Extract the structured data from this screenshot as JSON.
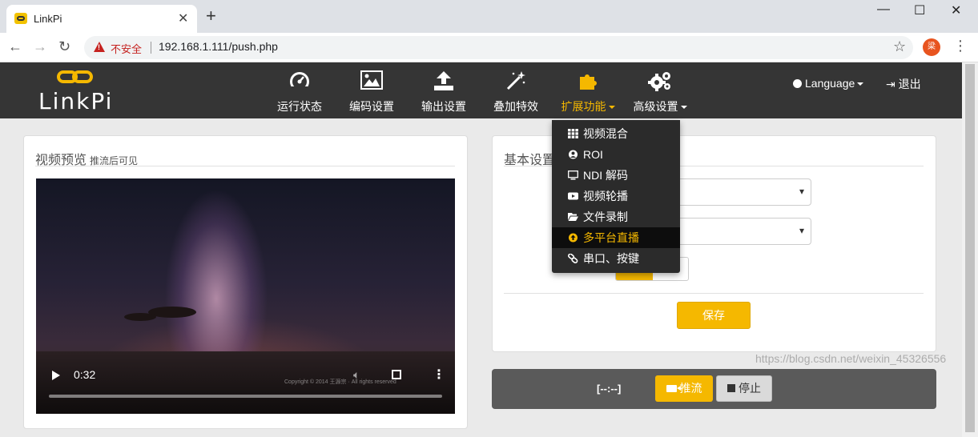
{
  "browser": {
    "tab_title": "LinkPi",
    "new_tab": "+",
    "close_tab": "✕",
    "insecure_label": "不安全",
    "url": "192.168.1.111/push.php",
    "profile_initial": "梁",
    "window_controls": {
      "minimize": "—",
      "maximize": "☐",
      "close": "✕"
    }
  },
  "navbar": {
    "brand": "LinkPi",
    "items": [
      {
        "label": "运行状态",
        "icon": "dashboard-icon"
      },
      {
        "label": "编码设置",
        "icon": "picture-icon"
      },
      {
        "label": "输出设置",
        "icon": "upload-icon"
      },
      {
        "label": "叠加特效",
        "icon": "magic-wand-icon"
      },
      {
        "label": "扩展功能",
        "icon": "puzzle-icon",
        "active": true
      },
      {
        "label": "高级设置",
        "icon": "gears-icon"
      }
    ],
    "language": "Language",
    "logout": "退出"
  },
  "dropdown": {
    "items": [
      {
        "label": "视频混合",
        "icon": "grid-icon"
      },
      {
        "label": "ROI",
        "icon": "user-circle-icon"
      },
      {
        "label": "NDI 解码",
        "icon": "monitor-icon"
      },
      {
        "label": "视频轮播",
        "icon": "youtube-play-icon"
      },
      {
        "label": "文件录制",
        "icon": "folder-open-icon"
      },
      {
        "label": "多平台直播",
        "icon": "arrow-circle-up-icon",
        "active": true
      },
      {
        "label": "串口、按键",
        "icon": "link-icon"
      }
    ]
  },
  "preview": {
    "title": "视频预览",
    "subtitle": "推流后可见",
    "time": "0:32",
    "copyright": "Copyright © 2014 王源宗 · All rights reserved"
  },
  "settings": {
    "title": "基本设置",
    "save_label": "保存"
  },
  "pushbar": {
    "timer": "[--:--]",
    "push_label": "推流",
    "stop_label": "停止"
  },
  "watermark": "https://blog.csdn.net/weixin_45326556",
  "colors": {
    "accent": "#f5b800",
    "navbar": "#353535",
    "dropdown": "#2b2b2b"
  }
}
